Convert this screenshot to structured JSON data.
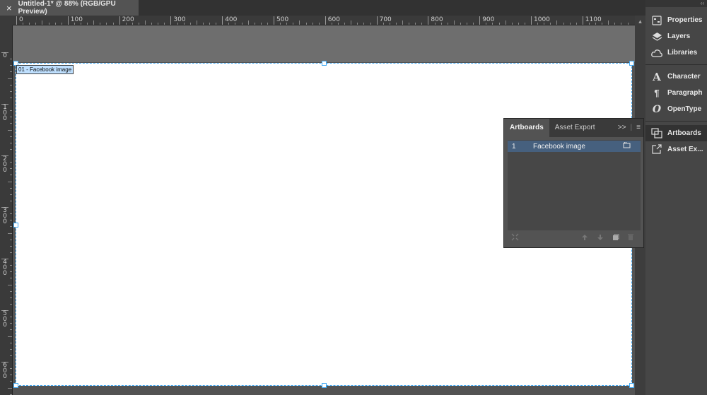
{
  "document_tab": {
    "close_glyph": "×",
    "title": "Untitled-1* @ 88% (RGB/GPU Preview)"
  },
  "ruler_top": {
    "labels": [
      "0",
      "100",
      "200",
      "300",
      "400",
      "500",
      "600",
      "700",
      "800",
      "900",
      "1000",
      "1100"
    ]
  },
  "ruler_left": {
    "labels": [
      "0",
      "100",
      "200",
      "300",
      "400",
      "500",
      "600"
    ]
  },
  "artboard": {
    "label": "01 - Facebook image"
  },
  "dock": {
    "collapse_glyph": "‹‹",
    "items": [
      {
        "label": "Properties",
        "icon": "properties-icon"
      },
      {
        "label": "Layers",
        "icon": "layers-icon"
      },
      {
        "label": "Libraries",
        "icon": "libraries-icon"
      },
      {
        "label": "Character",
        "icon": "character-icon"
      },
      {
        "label": "Paragraph",
        "icon": "paragraph-icon"
      },
      {
        "label": "OpenType",
        "icon": "opentype-icon"
      },
      {
        "label": "Artboards",
        "icon": "artboards-icon",
        "active": true
      },
      {
        "label": "Asset Ex...",
        "icon": "asset-export-icon"
      }
    ]
  },
  "panel": {
    "tabs": [
      {
        "label": "Artboards",
        "active": true
      },
      {
        "label": "Asset Export"
      }
    ],
    "expand_glyph": ">>",
    "menu_glyph": "≡",
    "rows": [
      {
        "number": "1",
        "name": "Facebook image"
      }
    ]
  },
  "colors": {
    "selection": "#3fa9f5",
    "row_selected": "#46607e"
  }
}
